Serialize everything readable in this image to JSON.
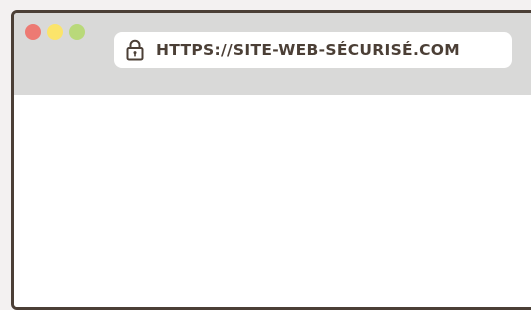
{
  "window": {
    "traffic_lights": [
      {
        "name": "close",
        "color": "#ed7a73"
      },
      {
        "name": "minimize",
        "color": "#fbe46a"
      },
      {
        "name": "maximize",
        "color": "#b9d97a"
      }
    ],
    "frame_color": "#4b3f36",
    "titlebar_color": "#d9d9d8"
  },
  "address_bar": {
    "icon": "lock-icon",
    "url": "HTTPS://SITE-WEB-SÉCURISÉ.COM"
  }
}
